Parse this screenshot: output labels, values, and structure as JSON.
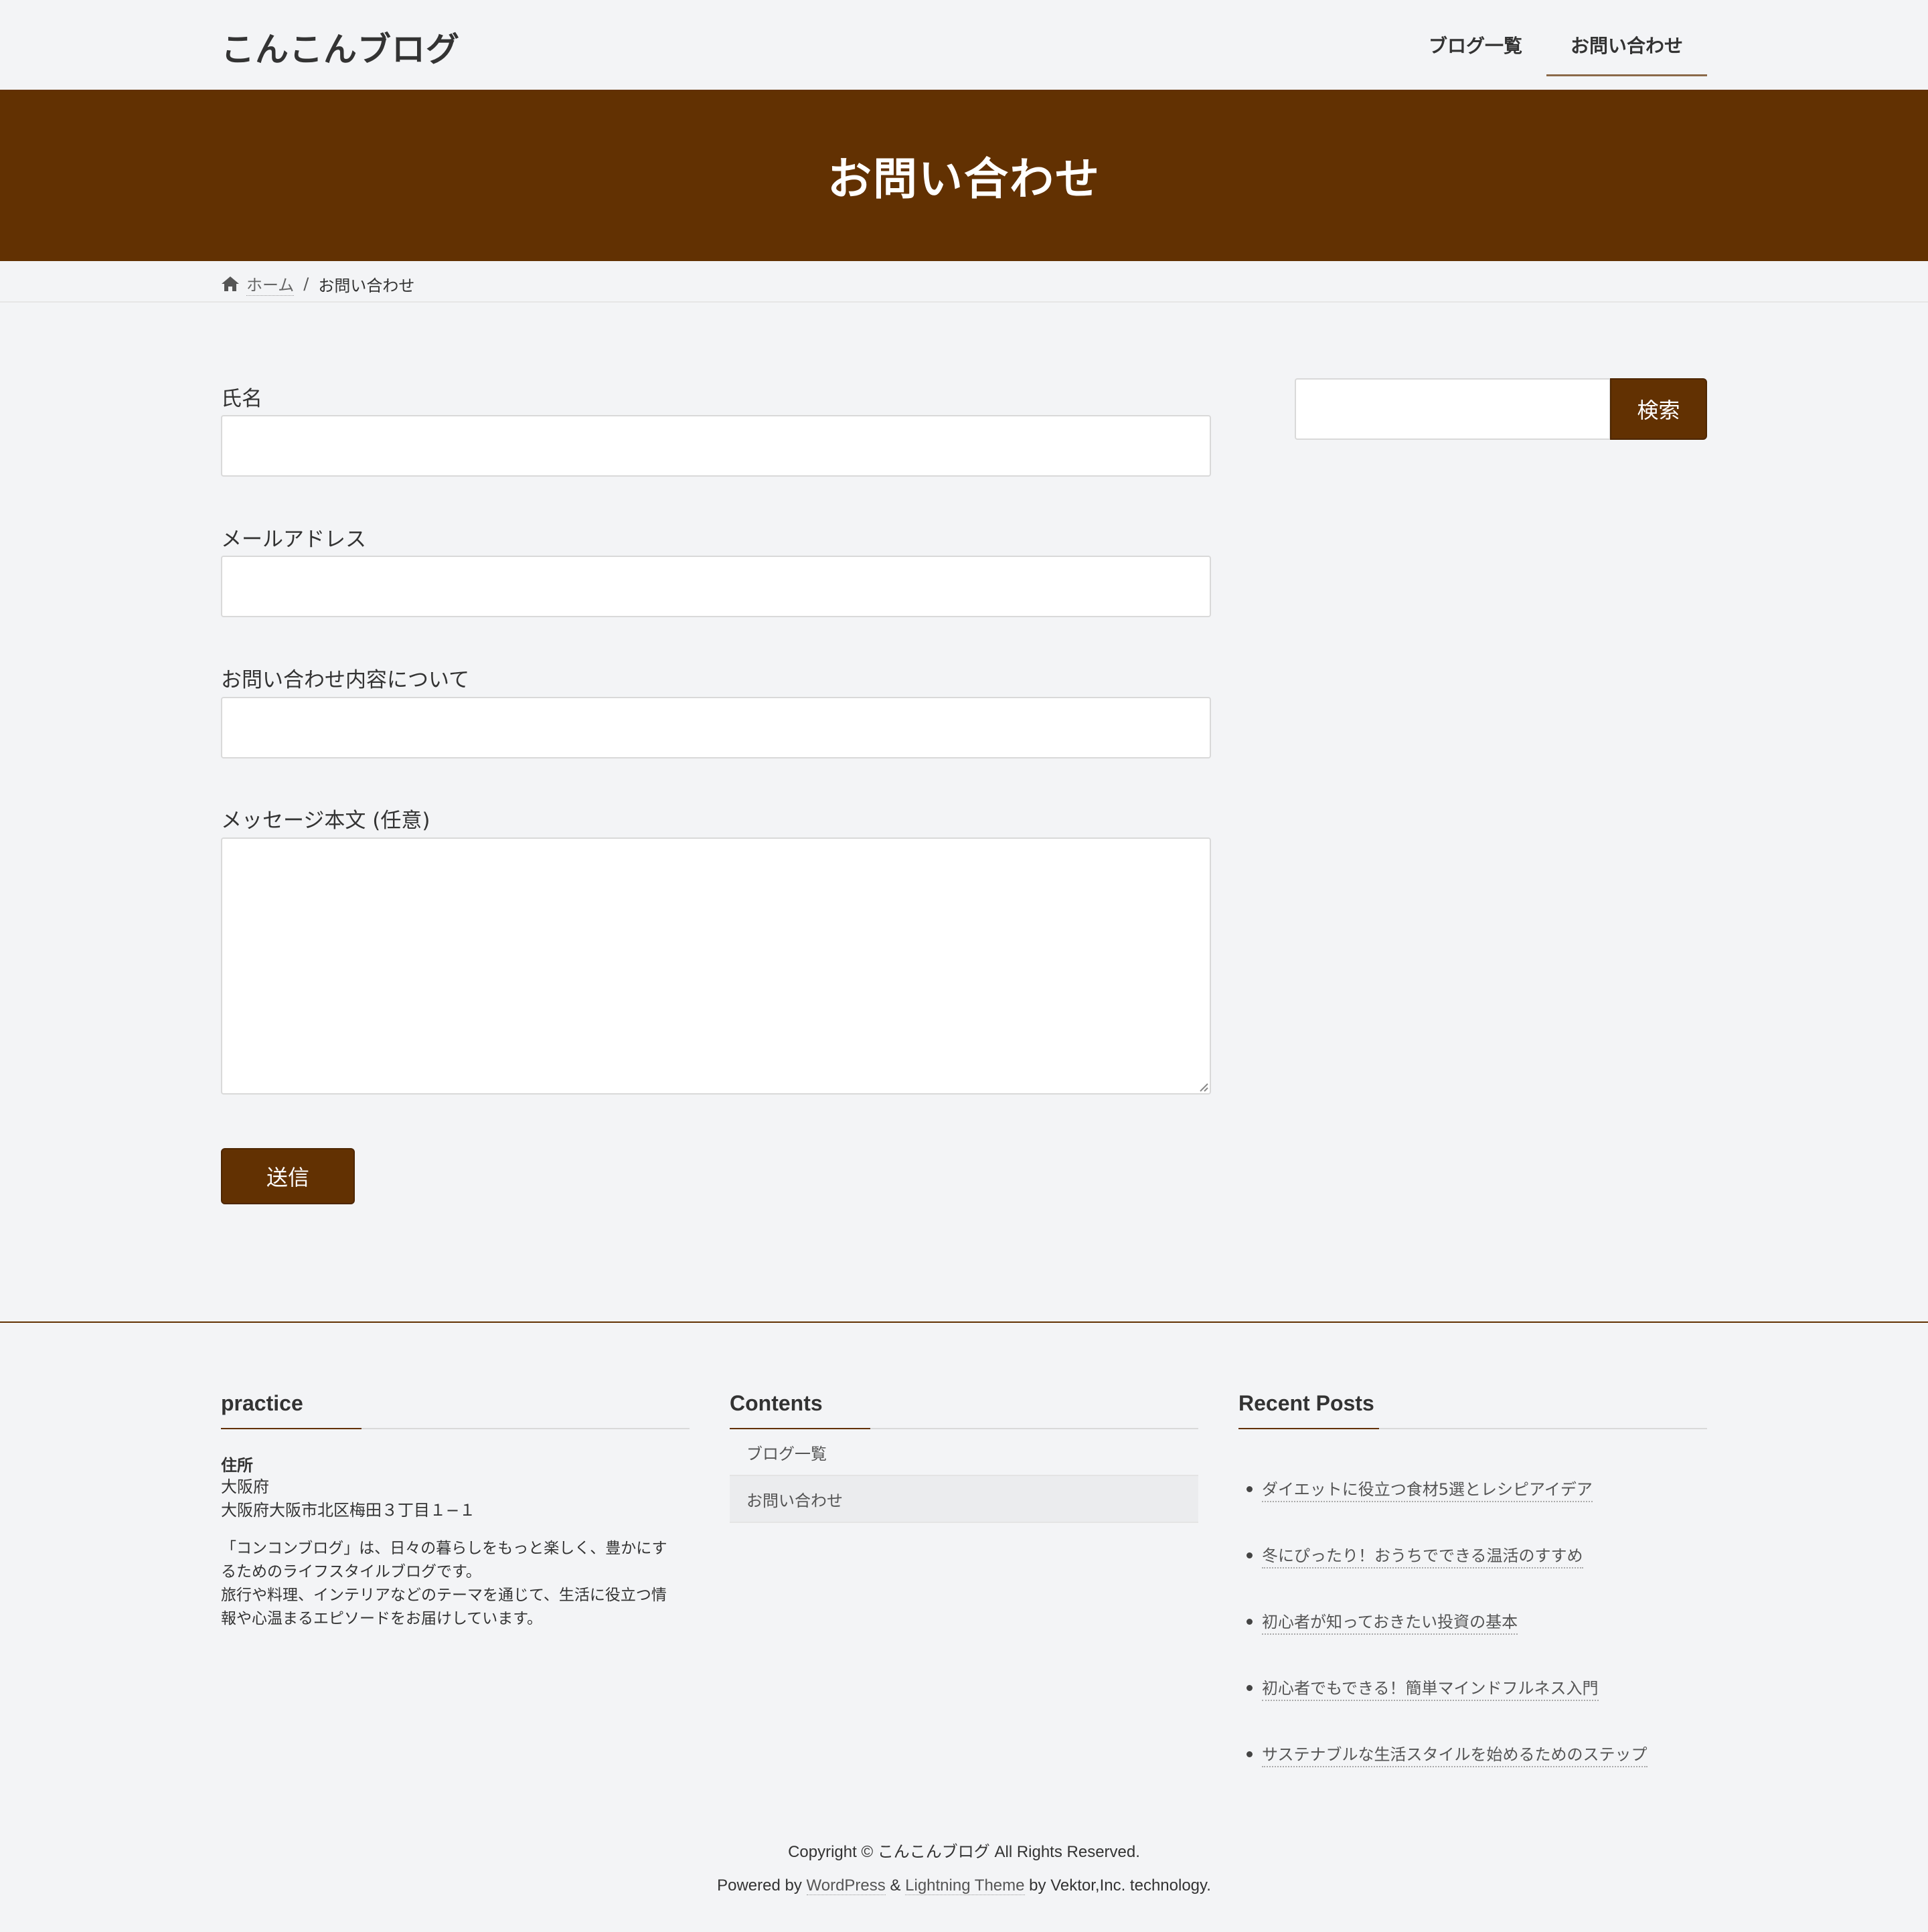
{
  "header": {
    "site_title": "こんこんブログ",
    "nav": [
      {
        "label": "ブログ一覧",
        "current": false
      },
      {
        "label": "お問い合わせ",
        "current": true
      }
    ]
  },
  "page": {
    "title": "お問い合わせ"
  },
  "breadcrumb": {
    "home": "ホーム",
    "separator": "/",
    "current": "お問い合わせ"
  },
  "form": {
    "name_label": "氏名",
    "name_value": "",
    "email_label": "メールアドレス",
    "email_value": "",
    "subject_label": "お問い合わせ内容について",
    "subject_value": "",
    "message_label": "メッセージ本文 (任意)",
    "message_value": "",
    "submit_label": "送信"
  },
  "sidebar": {
    "search_value": "",
    "search_button": "検索"
  },
  "footer": {
    "practice": {
      "title": "practice",
      "address_label": "住所",
      "address_line1": "大阪府",
      "address_line2": "大阪府大阪市北区梅田３丁目１−１",
      "about_line1": "「コンコンブログ」は、日々の暮らしをもっと楽しく、豊かにす",
      "about_line2": "るためのライフスタイルブログです。",
      "about_line3": "旅行や料理、インテリアなどのテーマを通じて、生活に役立つ情",
      "about_line4": "報や心温まるエピソードをお届けしています。"
    },
    "contents": {
      "title": "Contents",
      "items": [
        "ブログ一覧",
        "お問い合わせ"
      ]
    },
    "recent": {
      "title": "Recent Posts",
      "posts": [
        "ダイエットに役立つ食材5選とレシピアイデア",
        "冬にぴったり！おうちでできる温活のすすめ",
        "初心者が知っておきたい投資の基本",
        "初心者でもできる！簡単マインドフルネス入門",
        "サステナブルな生活スタイルを始めるためのステップ"
      ]
    },
    "copyright": "Copyright © こんこんブログ All Rights Reserved.",
    "powered": {
      "prefix": "Powered by",
      "wordpress": "WordPress",
      "amp": "&",
      "theme": "Lightning Theme",
      "suffix": "by Vektor,Inc. technology."
    }
  },
  "colors": {
    "accent": "#623102",
    "background": "#f3f4f6"
  },
  "icons": {
    "breadcrumb_home": "home-icon",
    "textarea_resize": "resize-grip-icon"
  }
}
